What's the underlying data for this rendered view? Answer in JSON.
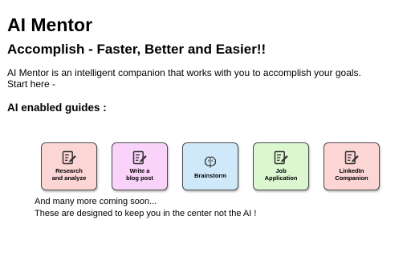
{
  "header": {
    "app_title": "AI Mentor",
    "tagline": "Accomplish - Faster, Better and Easier!!"
  },
  "intro": {
    "line1": "AI Mentor is an intelligent companion that works with you to accomplish your goals.",
    "line2": "Start here -"
  },
  "guides_section": {
    "heading": "AI enabled guides :",
    "items": [
      {
        "label": "Research\nand analyze",
        "icon": "edit-note-icon",
        "color": "#fcd5d5"
      },
      {
        "label": "Write a\nblog post",
        "icon": "edit-note-icon",
        "color": "#f9d3f9"
      },
      {
        "label": "Brainstorm",
        "icon": "brain-icon",
        "color": "#cfe9fb"
      },
      {
        "label": "Job\nApplication",
        "icon": "edit-note-icon",
        "color": "#daf7d0"
      },
      {
        "label": "LinkedIn\nCompanion",
        "icon": "edit-note-icon",
        "color": "#fcd5d5"
      }
    ]
  },
  "footer": {
    "line1": "And many more coming soon...",
    "line2": "These are designed to keep you in the center not the AI !"
  }
}
